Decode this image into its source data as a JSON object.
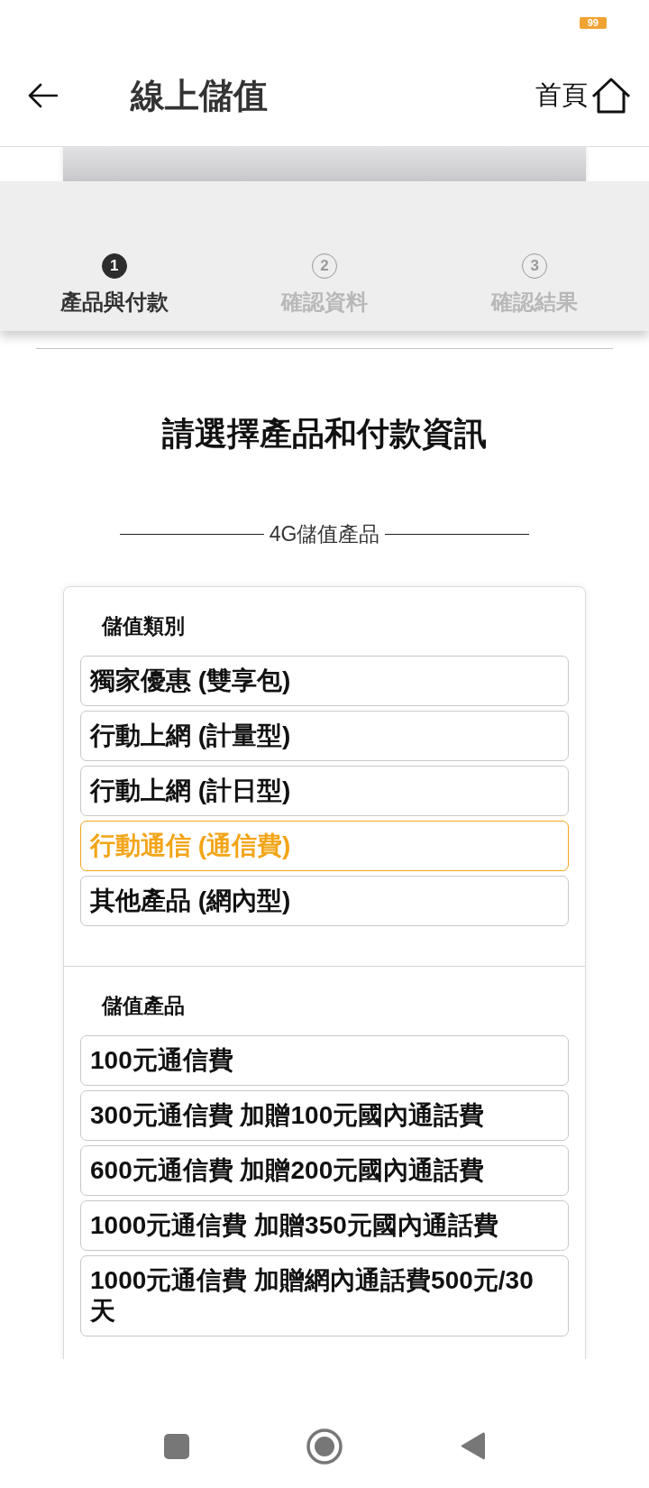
{
  "status_bar": {
    "badge": "99"
  },
  "header": {
    "title": "線上儲值",
    "home_label": "首頁"
  },
  "stepper": {
    "steps": [
      {
        "number": "1",
        "label": "產品與付款",
        "selected": true
      },
      {
        "number": "2",
        "label": "確認資料",
        "selected": false
      },
      {
        "number": "3",
        "label": "確認結果",
        "selected": false
      }
    ]
  },
  "heading": "請選擇產品和付款資訊",
  "section_title": "4G儲值產品",
  "category_group": {
    "label": "儲值類別",
    "options": [
      {
        "label": "獨家優惠 (雙享包)",
        "selected": false
      },
      {
        "label": "行動上網 (計量型)",
        "selected": false
      },
      {
        "label": "行動上網 (計日型)",
        "selected": false
      },
      {
        "label": "行動通信 (通信費)",
        "selected": true
      },
      {
        "label": "其他產品 (網內型)",
        "selected": false
      }
    ]
  },
  "product_group": {
    "label": "儲值產品",
    "options": [
      {
        "label": "100元通信費",
        "selected": false
      },
      {
        "label": "300元通信費 加贈100元國內通話費",
        "selected": false
      },
      {
        "label": "600元通信費 加贈200元國內通話費",
        "selected": false
      },
      {
        "label": "1000元通信費 加贈350元國內通話費",
        "selected": false
      },
      {
        "label": "1000元通信費 加贈網內通話費500元/30天",
        "selected": false
      }
    ]
  }
}
